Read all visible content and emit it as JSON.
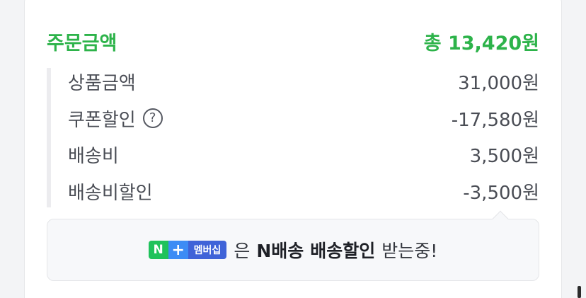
{
  "order": {
    "title": "주문금액",
    "total": "총 13,420원"
  },
  "rows": [
    {
      "label": "상품금액",
      "value": "31,000원"
    },
    {
      "label": "쿠폰할인",
      "value": "-17,580원",
      "help_icon": "question-circle-icon"
    },
    {
      "label": "배송비",
      "value": "3,500원"
    },
    {
      "label": "배송비할인",
      "value": "-3,500원"
    }
  ],
  "banner": {
    "badge_n": "N",
    "badge_plus": "+",
    "badge_text": "멤버십",
    "text_pre": "은",
    "text_bold_1": "N배송",
    "text_bold_2": "배송할인",
    "text_post": "받는중!",
    "help_symbol": "?"
  },
  "colors": {
    "accent": "#2db34a",
    "badge_n": "#1fc25b",
    "badge_plus": "#3d8cf5",
    "badge_text": "#3f63d8"
  }
}
